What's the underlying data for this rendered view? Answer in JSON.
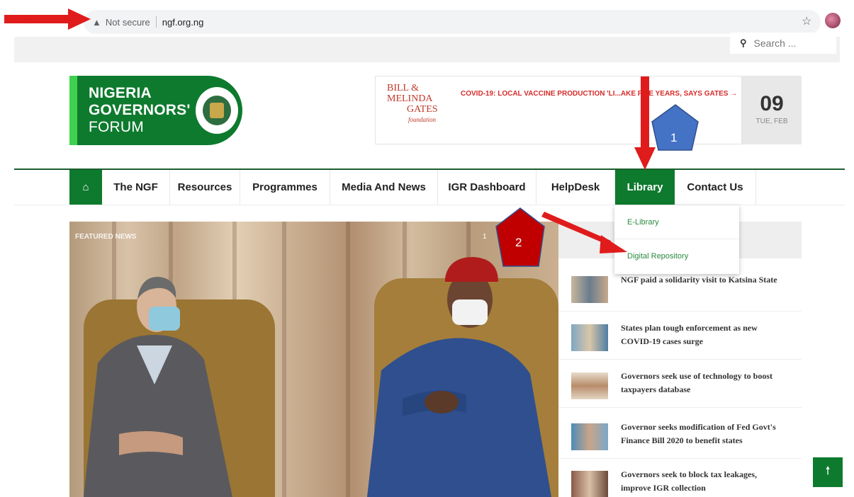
{
  "browser": {
    "security_label": "Not secure",
    "url": "ngf.org.ng"
  },
  "search": {
    "placeholder": "Search ..."
  },
  "logo": {
    "line1": "NIGERIA",
    "line2": "GOVERNORS'",
    "line3": "FORUM"
  },
  "ad": {
    "sponsor_line1": "BILL &",
    "sponsor_line2": "MELINDA",
    "sponsor_line3": "GATES",
    "sponsor_line4": "foundation",
    "headline": "COVID-19: LOCAL VACCINE PRODUCTION 'LI...AKE FIVE YEARS, SAYS GATES →"
  },
  "date": {
    "day": "09",
    "weekday": "TUE, FEB"
  },
  "nav": {
    "items": [
      {
        "label": "The NGF"
      },
      {
        "label": "Resources"
      },
      {
        "label": "Programmes"
      },
      {
        "label": "Media And News"
      },
      {
        "label": "IGR Dashboard"
      },
      {
        "label": "HelpDesk"
      },
      {
        "label": "Library"
      },
      {
        "label": "Contact Us"
      }
    ]
  },
  "dropdown": {
    "items": [
      {
        "label": "E-Library"
      },
      {
        "label": "Digital Repository"
      }
    ]
  },
  "featured": {
    "label": "FEATURED NEWS",
    "counter": "1"
  },
  "news": [
    {
      "title": "NGF paid a solidarity visit to Katsina State"
    },
    {
      "title": "States plan tough enforcement as new COVID-19 cases surge"
    },
    {
      "title": "Governors seek use of technology to boost taxpayers database"
    },
    {
      "title": "Governor seeks modification of Fed Govt's Finance Bill 2020 to benefit states"
    },
    {
      "title": "Governors seek to block tax leakages, improve IGR collection"
    }
  ],
  "annotations": {
    "step1": "1",
    "step2": "2"
  },
  "colors": {
    "brand_green": "#0e7a2e",
    "arrow_red": "#e01b1b",
    "step1_fill": "#4472c4",
    "step2_fill": "#c00000"
  }
}
